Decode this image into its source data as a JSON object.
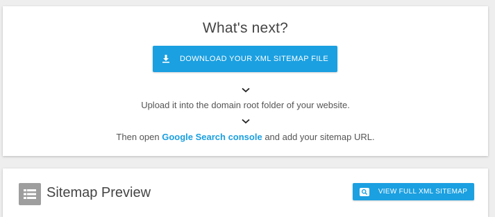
{
  "next_steps": {
    "title": "What's next?",
    "download_button": "DOWNLOAD YOUR XML SITEMAP FILE",
    "step_upload": "Upload it into the domain root folder of your website.",
    "step_open_prefix": "Then open ",
    "step_open_link": "Google Search console",
    "step_open_suffix": " and add your sitemap URL."
  },
  "preview": {
    "title": "Sitemap Preview",
    "view_button": "VIEW FULL XML SITEMAP"
  },
  "icons": {
    "download": "download-icon",
    "chevron": "chevron-down-icon",
    "list": "list-icon",
    "search": "search-icon"
  },
  "colors": {
    "accent": "#1ba0e1",
    "link": "#1a9fe0",
    "icon_gray": "#9e9e9e",
    "background": "#eeeeee"
  }
}
